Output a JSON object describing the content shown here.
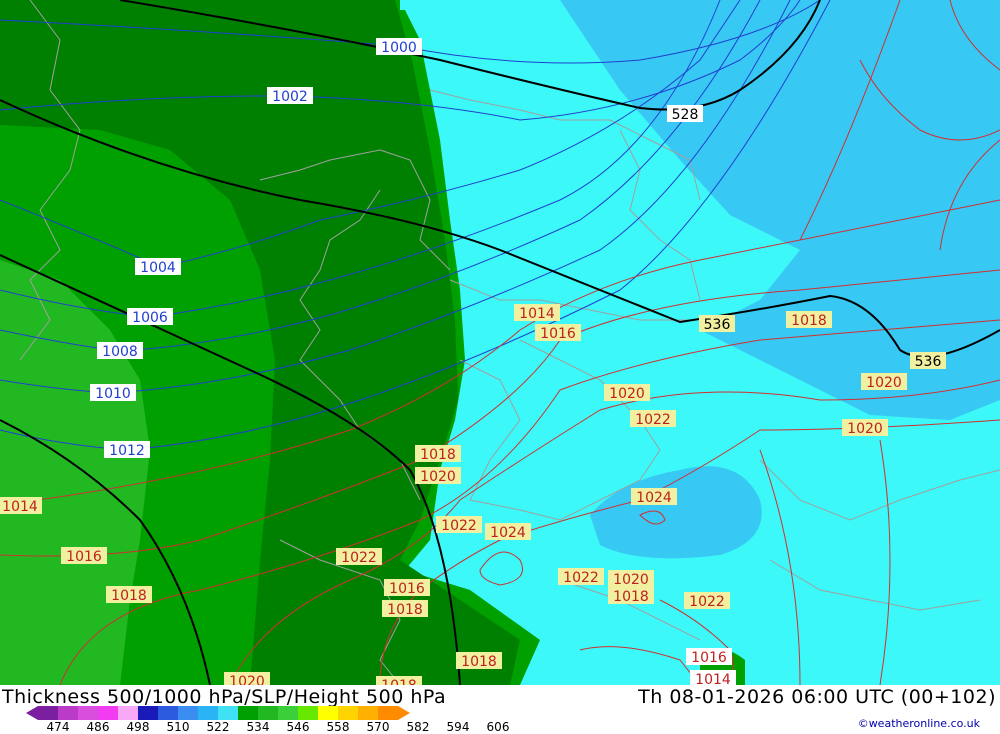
{
  "title": "Thickness 500/1000 hPa/SLP/Height 500 hPa",
  "valid_time": "Th 08-01-2026 06:00 UTC (00+102)",
  "credit": "©weatheronline.co.uk",
  "legend": {
    "ticks": [
      "474",
      "486",
      "498",
      "510",
      "522",
      "534",
      "546",
      "558",
      "570",
      "582",
      "594",
      "606"
    ],
    "colors": [
      "#7a1fa0",
      "#b93bc8",
      "#d84fdd",
      "#f23cf2",
      "#f7a8f7",
      "#1a1ab8",
      "#2d5be0",
      "#3b8ef0",
      "#2ab4f5",
      "#40e0f5",
      "#00a000",
      "#22b822",
      "#3ccf3c",
      "#66e800",
      "#ffff00",
      "#ffd400",
      "#ffb000",
      "#ff8c00"
    ]
  },
  "thickness_labels": [
    {
      "text": "528"
    },
    {
      "text": "536"
    },
    {
      "text": "536"
    }
  ],
  "slp_labels_blue": [
    {
      "text": "1000"
    },
    {
      "text": "1002"
    },
    {
      "text": "1004"
    },
    {
      "text": "1006"
    },
    {
      "text": "1008"
    },
    {
      "text": "1010"
    },
    {
      "text": "1012"
    }
  ],
  "slp_labels_red": [
    {
      "text": "1014"
    },
    {
      "text": "1016"
    },
    {
      "text": "1018"
    },
    {
      "text": "1020"
    },
    {
      "text": "1020"
    },
    {
      "text": "1022"
    },
    {
      "text": "1024"
    },
    {
      "text": "1018"
    },
    {
      "text": "1020"
    },
    {
      "text": "1022"
    },
    {
      "text": "1024"
    },
    {
      "text": "1022"
    },
    {
      "text": "1020"
    },
    {
      "text": "1018"
    },
    {
      "text": "1018"
    },
    {
      "text": "1022"
    },
    {
      "text": "1020"
    },
    {
      "text": "1018"
    },
    {
      "text": "1022"
    },
    {
      "text": "1018"
    },
    {
      "text": "1016"
    },
    {
      "text": "1014"
    },
    {
      "text": "1014"
    },
    {
      "text": "1016"
    },
    {
      "text": "1018"
    },
    {
      "text": "1020"
    },
    {
      "text": "1016"
    }
  ]
}
